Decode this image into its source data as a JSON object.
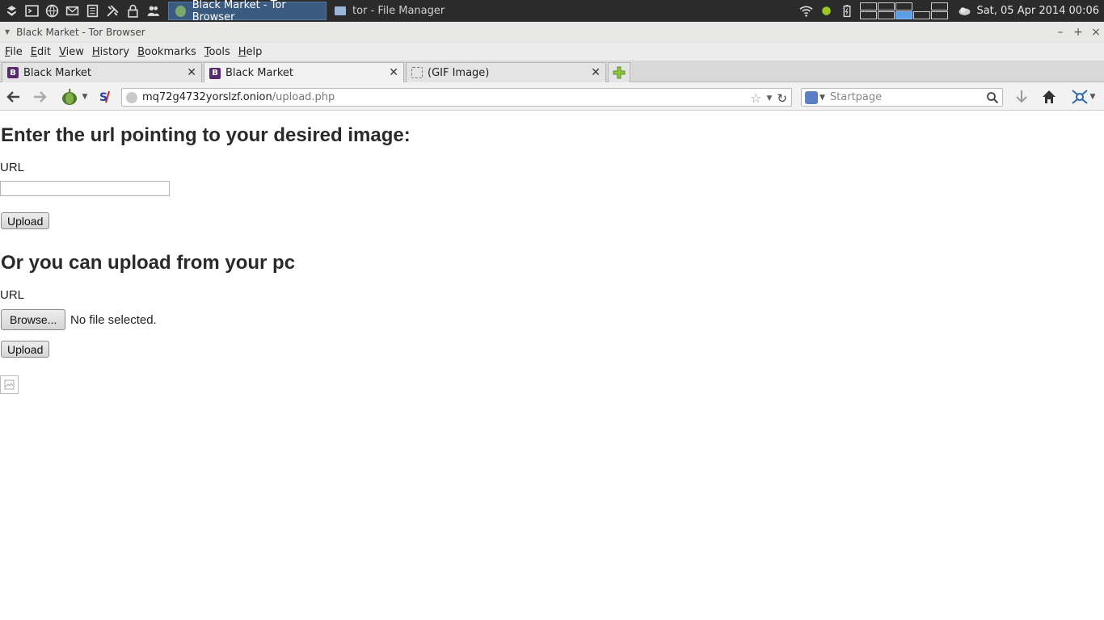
{
  "desktop_panel": {
    "tasks": [
      {
        "label": "Black Market - Tor Browser",
        "active": true
      },
      {
        "label": "tor - File Manager",
        "active": false
      }
    ],
    "clock": "Sat, 05 Apr 2014 00:06"
  },
  "window": {
    "title": "Black Market - Tor Browser"
  },
  "menu": {
    "items": [
      "File",
      "Edit",
      "View",
      "History",
      "Bookmarks",
      "Tools",
      "Help"
    ]
  },
  "tabs": [
    {
      "label": "Black Market",
      "favicon": "B",
      "selected": false
    },
    {
      "label": "Black Market",
      "favicon": "B",
      "selected": true
    },
    {
      "label": "(GIF Image)",
      "favicon": "",
      "selected": false
    }
  ],
  "navbar": {
    "url_host": "mq72g4732yorslzf.onion",
    "url_path": "/upload.php",
    "search_placeholder": "Startpage"
  },
  "page": {
    "heading_url": "Enter the url pointing to your desired image:",
    "url_label": "URL",
    "upload_button_1": "Upload",
    "heading_pc": "Or you can upload from your pc",
    "file_label": "URL",
    "browse_button": "Browse...",
    "no_file_text": "No file selected.",
    "upload_button_2": "Upload"
  },
  "icons": {
    "panel": [
      "menu-icon",
      "terminal-icon",
      "browser-icon",
      "mail-icon",
      "notes-icon",
      "settings-icon",
      "lock-icon",
      "users-icon"
    ],
    "tray": [
      "wifi-icon",
      "status-dot-icon",
      "battery-icon",
      "weather-icon"
    ],
    "nav": [
      "back-icon",
      "forward-icon",
      "tor-onion-icon",
      "noscript-icon",
      "reload-icon",
      "bookmark-star-icon",
      "download-icon",
      "home-icon",
      "addon-icon"
    ]
  },
  "colors": {
    "panel_bg": "#2b2b2b",
    "active_task_bg": "#3a5a80",
    "workspace_active": "#5b9ee6",
    "tor_green": "#4a7a2a"
  }
}
